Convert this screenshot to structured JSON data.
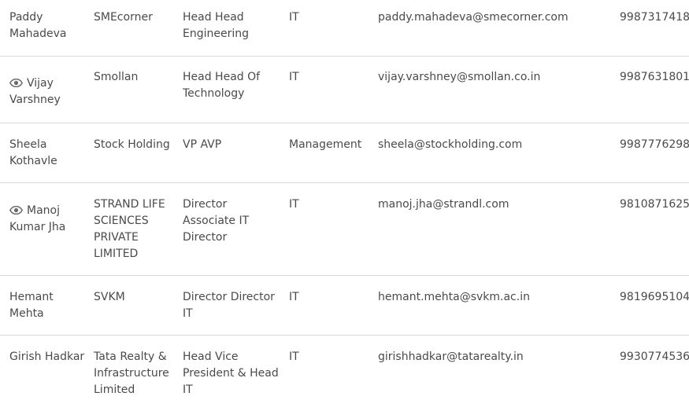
{
  "contacts": [
    {
      "name": "Paddy Mahadeva",
      "viewed": false,
      "company": "SMEcorner",
      "title": "Head Head Engineering",
      "department": "IT",
      "email": "paddy.mahadeva@smecorner.com",
      "phone": "9987317418"
    },
    {
      "name": "Vijay Varshney",
      "viewed": true,
      "company": "Smollan",
      "title": "Head Head Of Technology",
      "department": "IT",
      "email": "vijay.varshney@smollan.co.in",
      "phone": "9987631801"
    },
    {
      "name": "Sheela Kothavle",
      "viewed": false,
      "company": "Stock Holding",
      "title": "VP AVP",
      "department": "Management",
      "email": "sheela@stockholding.com",
      "phone": "9987776298"
    },
    {
      "name": "Manoj Kumar Jha",
      "viewed": true,
      "company": "STRAND LIFE SCIENCES PRIVATE LIMITED",
      "title": "Director Associate IT Director",
      "department": "IT",
      "email": "manoj.jha@strandl.com",
      "phone": "9810871625"
    },
    {
      "name": "Hemant Mehta",
      "viewed": false,
      "company": "SVKM",
      "title": "Director Director IT",
      "department": "IT",
      "email": "hemant.mehta@svkm.ac.in",
      "phone": "9819695104"
    },
    {
      "name": "Girish Hadkar",
      "viewed": false,
      "company": "Tata Realty & Infrastructure Limited",
      "title": "Head Vice President & Head IT",
      "department": "IT",
      "email": "girishhadkar@tatarealty.in",
      "phone": "9930774536"
    }
  ],
  "icons": {
    "viewed": "eye-icon"
  },
  "colors": {
    "text": "#4a4a4a",
    "divider": "#d9d9d9",
    "icon": "#6b6b6b"
  }
}
